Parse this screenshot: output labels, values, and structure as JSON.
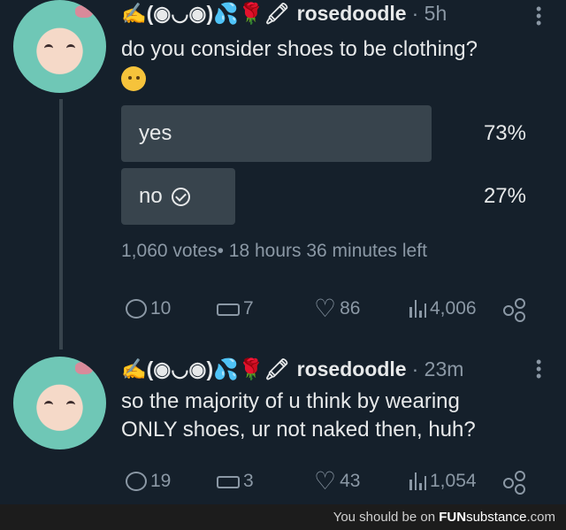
{
  "tweet1": {
    "display_name": "✍(◉◡◉)💦🌹🖍",
    "handle": "rosedoodle",
    "time": "· 5h",
    "text": "do you consider shoes to be clothing?",
    "emoji_icon": "thinking-face-emoji",
    "poll": {
      "options": [
        {
          "label": "yes",
          "percent": "73%",
          "fraction": 0.73,
          "selected": false
        },
        {
          "label": "no",
          "percent": "27%",
          "fraction": 0.27,
          "selected": true
        }
      ],
      "votes": "1,060 votes",
      "time_left": "• 18 hours 36 minutes left"
    },
    "actions": {
      "replies": "10",
      "retweets": "7",
      "likes": "86",
      "views": "4,006"
    }
  },
  "tweet2": {
    "display_name": "✍(◉◡◉)💦🌹🖍",
    "handle": "rosedoodle",
    "time": "· 23m",
    "text_line1": "so the majority of u think by wearing",
    "text_line2": "ONLY shoes, ur not naked then, huh?",
    "actions": {
      "replies": "19",
      "retweets": "3",
      "likes": "43",
      "views": "1,054"
    }
  },
  "footer": {
    "prefix": "You should be on ",
    "brand_a": "FUN",
    "brand_b": "substance",
    "brand_c": ".com"
  },
  "colors": {
    "background": "#15202b",
    "poll_bar": "#38444d",
    "muted": "#8b98a5"
  }
}
